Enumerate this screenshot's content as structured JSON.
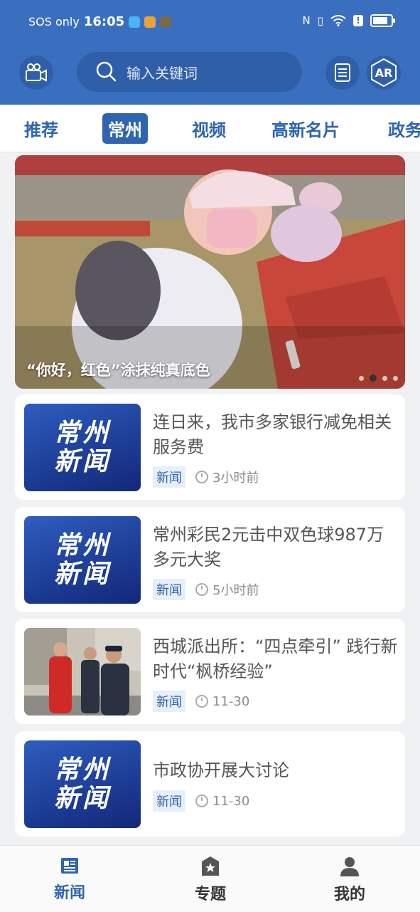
{
  "status_bar": {
    "carrier": "SOS only",
    "time": "16:05"
  },
  "header": {
    "search_placeholder": "输入关键词",
    "ar_label": "AR"
  },
  "tabs": [
    {
      "label": "推荐"
    },
    {
      "label": "常州"
    },
    {
      "label": "视频"
    },
    {
      "label": "高新名片"
    },
    {
      "label": "政务"
    }
  ],
  "banner": {
    "caption": "“你好，红色”涂抹纯真底色",
    "page_count": 4,
    "active_page": 2
  },
  "news": [
    {
      "title": "连日来，我市多家银行减免相关服务费",
      "tag": "新闻",
      "time": "3小时前",
      "thumb_type": "logo",
      "thumb_text_1": "常州",
      "thumb_text_2": "新闻"
    },
    {
      "title": "常州彩民2元击中双色球987万多元大奖",
      "tag": "新闻",
      "time": "5小时前",
      "thumb_type": "logo",
      "thumb_text_1": "常州",
      "thumb_text_2": "新闻"
    },
    {
      "title": "西城派出所：“四点牵引” 践行新时代“枫桥经验”",
      "tag": "新闻",
      "time": "11-30",
      "thumb_type": "photo"
    },
    {
      "title": "市政协开展大讨论",
      "tag": "新闻",
      "time": "11-30",
      "thumb_type": "logo",
      "thumb_text_1": "常州",
      "thumb_text_2": "新闻"
    }
  ],
  "bottom_nav": [
    {
      "label": "新闻",
      "icon": "newspaper-icon"
    },
    {
      "label": "专题",
      "icon": "star-badge-icon"
    },
    {
      "label": "我的",
      "icon": "person-icon"
    }
  ],
  "colors": {
    "brand_blue": "#3a6fc0",
    "tab_blue": "#2f64b0",
    "background": "#f0f1f3"
  }
}
